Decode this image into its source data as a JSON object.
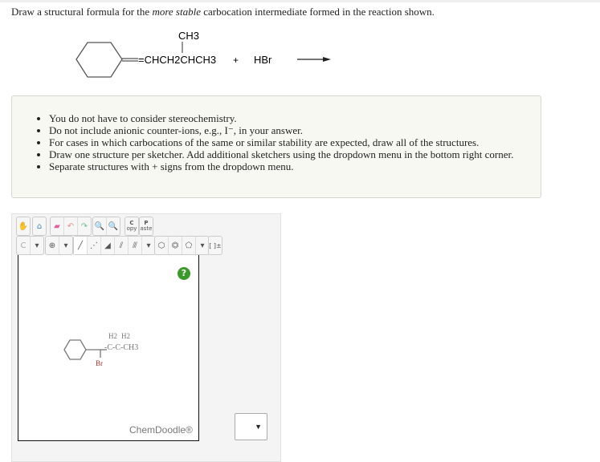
{
  "question": {
    "pre": "Draw a structural formula for the ",
    "em": "more stable",
    "post": " carbocation intermediate formed in the reaction shown."
  },
  "reaction": {
    "substituent": "CH3",
    "chain": "=CHCH2CHCH3",
    "plus": "+",
    "reagent": "HBr"
  },
  "instructions": [
    "You do not have to consider stereochemistry.",
    "Do not include anionic counter-ions, e.g., I⁻, in your answer.",
    "For cases in which carbocations of the same or similar stability are expected, draw all of the structures.",
    "Draw one structure per sketcher. Add additional sketchers using the dropdown menu in the bottom right corner.",
    "Separate structures with + signs from the dropdown menu."
  ],
  "toolbar": {
    "copy": "C",
    "copy_sub": "opy",
    "paste": "P",
    "paste_sub": "aste",
    "element": "C",
    "charge": "⊕",
    "bracket": "[ ]±"
  },
  "drawing": {
    "h2a": "H2",
    "h2b": "H2",
    "chain": "-C-C-CH3",
    "br": "Br"
  },
  "help": "?",
  "brand": "ChemDoodle®",
  "colors": {
    "help": "#3a9a2a",
    "br": "#b03030"
  }
}
